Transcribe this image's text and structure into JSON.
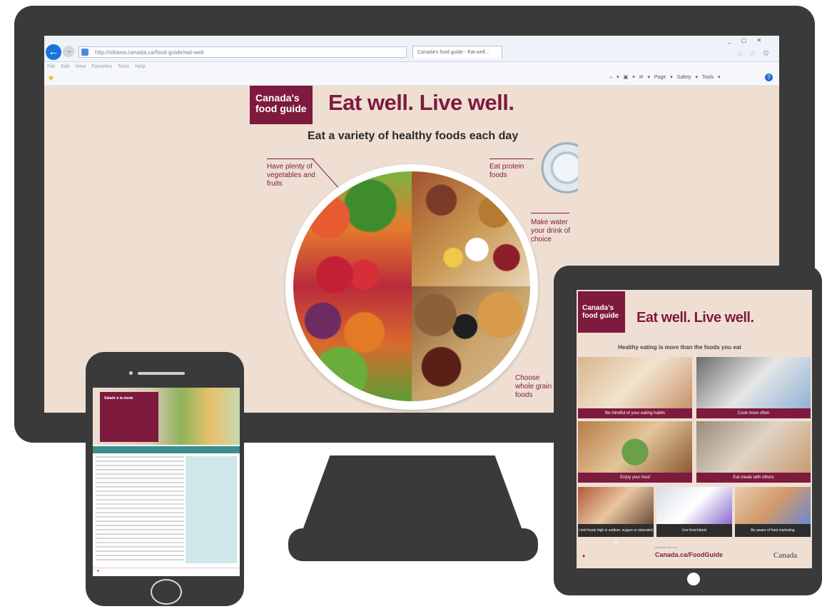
{
  "browser": {
    "address_url": "http://ottawa.canada.ca/food-guide/eat-well",
    "tab_label": "Canada's food guide - Eat well...",
    "window_buttons": "_ ▢ ✕",
    "home_icons": "⌂ ☆ ⚙",
    "menu": "File  Edit  View  Favorites  Tools  Help",
    "command_items": "⌂ ▾  ▣ ▾  ✉ ▾  Page ▾  Safety ▾  Tools ▾"
  },
  "poster": {
    "logo_text": "Canada's food guide",
    "headline": "Eat well. Live well.",
    "subhead": "Eat a variety of healthy foods each day",
    "notes": {
      "vegetables": "Have plenty of vegetables and fruits",
      "protein": "Eat protein foods",
      "water": "Make water your drink of choice",
      "grains": "Choose whole grain foods"
    }
  },
  "phone": {
    "recipe_title": "Salade à la mode"
  },
  "tablet": {
    "logo_text": "Canada's food guide",
    "headline": "Eat well. Live well.",
    "subhead": "Healthy eating is more than the foods you eat",
    "cards": [
      "Be mindful of your eating habits",
      "Cook more often",
      "Enjoy your food",
      "Eat meals with others"
    ],
    "cards_small": [
      "Limit foods high in sodium, sugars or saturated fat",
      "Use food labels",
      "Be aware of food marketing"
    ],
    "footer_note": "Discover more at",
    "footer_url": "Canada.ca/FoodGuide",
    "footer_brand": "Canada"
  },
  "colors": {
    "brand": "#7e1a3e",
    "background": "#efdfd3",
    "device_frame": "#3a3a3a"
  }
}
